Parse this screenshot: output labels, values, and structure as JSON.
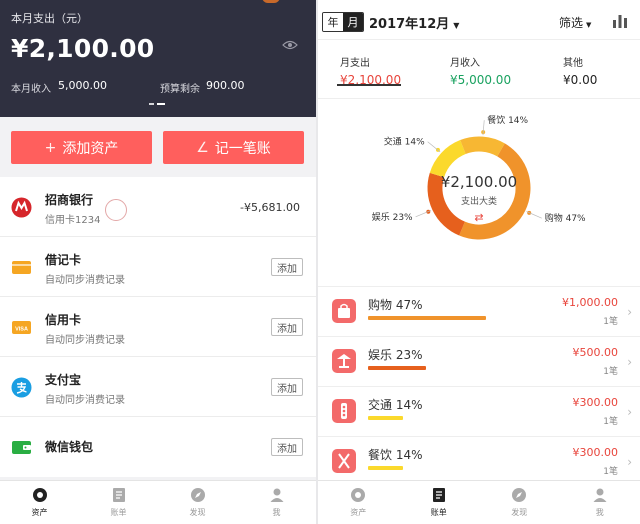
{
  "left": {
    "header": {
      "title": "本月支出（元）",
      "amount": "¥2,100.00",
      "income_label": "本月收入",
      "income_value": "5,000.00",
      "budget_label": "预算剩余",
      "budget_value": "900.00"
    },
    "buttons": {
      "add_asset": "添加资产",
      "record": "记一笔账"
    },
    "accounts": [
      {
        "name": "招商银行",
        "sub": "信用卡1234",
        "value": "-¥5,681.00",
        "icon": "cmb-bank-icon"
      },
      {
        "name": "借记卡",
        "sub": "自动同步消费记录",
        "action": "添加",
        "icon": "debit-card-icon"
      },
      {
        "name": "信用卡",
        "sub": "自动同步消费记录",
        "action": "添加",
        "icon": "visa-card-icon"
      },
      {
        "name": "支付宝",
        "sub": "自动同步消费记录",
        "action": "添加",
        "icon": "alipay-icon"
      },
      {
        "name": "微信钱包",
        "action": "添加",
        "icon": "wechat-wallet-icon"
      }
    ],
    "tabbar": [
      "资产",
      "账单",
      "发现",
      "我"
    ],
    "active_tab": "资产"
  },
  "right": {
    "segment": {
      "year": "年",
      "month": "月"
    },
    "month_label": "2017年12月",
    "filter_label": "筛选",
    "summary": [
      {
        "key": "月支出",
        "value": "¥2,100.00",
        "color": "#e8453c"
      },
      {
        "key": "月收入",
        "value": "¥5,000.00",
        "color": "#1aa260"
      },
      {
        "key": "其他",
        "value": "¥0.00",
        "color": "#222222"
      }
    ],
    "donut": {
      "center_amount": "¥2,100.00",
      "center_label": "支出大类",
      "segments": [
        {
          "name": "购物",
          "pct": 47,
          "color": "#f0932b"
        },
        {
          "name": "娱乐",
          "pct": 23,
          "color": "#e6601d"
        },
        {
          "name": "交通",
          "pct": 14,
          "color": "#fbd92c"
        },
        {
          "name": "餐饮",
          "pct": 14,
          "color": "#f7b733"
        }
      ],
      "callouts": [
        "购物 47%",
        "娱乐 23%",
        "交通 14%",
        "餐饮 14%"
      ]
    },
    "categories": [
      {
        "label": "购物 47%",
        "amount": "¥1,000.00",
        "count": "1笔",
        "pct": 47,
        "color": "#f0932b",
        "icon": "shopping-bag-icon"
      },
      {
        "label": "娱乐 23%",
        "amount": "¥500.00",
        "count": "1笔",
        "pct": 23,
        "color": "#e6601d",
        "icon": "entertainment-icon"
      },
      {
        "label": "交通 14%",
        "amount": "¥300.00",
        "count": "1笔",
        "pct": 14,
        "color": "#fbd92c",
        "icon": "traffic-light-icon"
      },
      {
        "label": "餐饮 14%",
        "amount": "¥300.00",
        "count": "1笔",
        "pct": 14,
        "color": "#fbd92c",
        "icon": "dining-icon"
      }
    ],
    "tabbar": [
      "资产",
      "账单",
      "发现",
      "我"
    ],
    "active_tab": "账单"
  }
}
